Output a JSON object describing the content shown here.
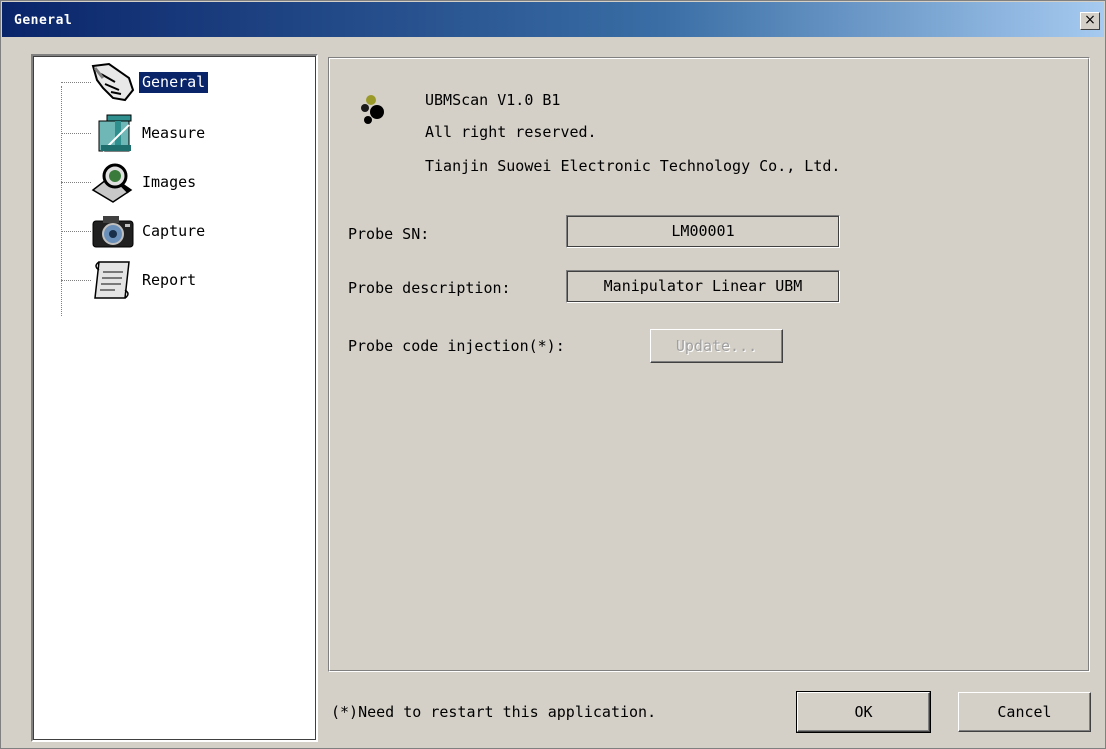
{
  "window": {
    "title": "General",
    "close_glyph": "×"
  },
  "tree": {
    "items": [
      {
        "label": "General",
        "icon": "pointing-hand-icon",
        "selected": true
      },
      {
        "label": "Measure",
        "icon": "caliper-icon",
        "selected": false
      },
      {
        "label": "Images",
        "icon": "magnifier-image-icon",
        "selected": false
      },
      {
        "label": "Capture",
        "icon": "camera-icon",
        "selected": false
      },
      {
        "label": "Report",
        "icon": "scroll-icon",
        "selected": false
      }
    ]
  },
  "about": {
    "product": "UBMScan V1.0 B1",
    "rights": "All right reserved.",
    "company": "Tianjin Suowei Electronic Technology Co., Ltd."
  },
  "fields": {
    "probe_sn_label": "Probe SN:",
    "probe_sn_value": "LM00001",
    "probe_desc_label": "Probe description:",
    "probe_desc_value": "Manipulator Linear UBM",
    "probe_code_label": "Probe code injection(*):",
    "update_button": "Update..."
  },
  "footer": {
    "note": "(*)Need to restart this application.",
    "ok_label": "OK",
    "cancel_label": "Cancel"
  },
  "colors": {
    "selection": "#0a246a",
    "dialog_face": "#d4d0c8"
  }
}
